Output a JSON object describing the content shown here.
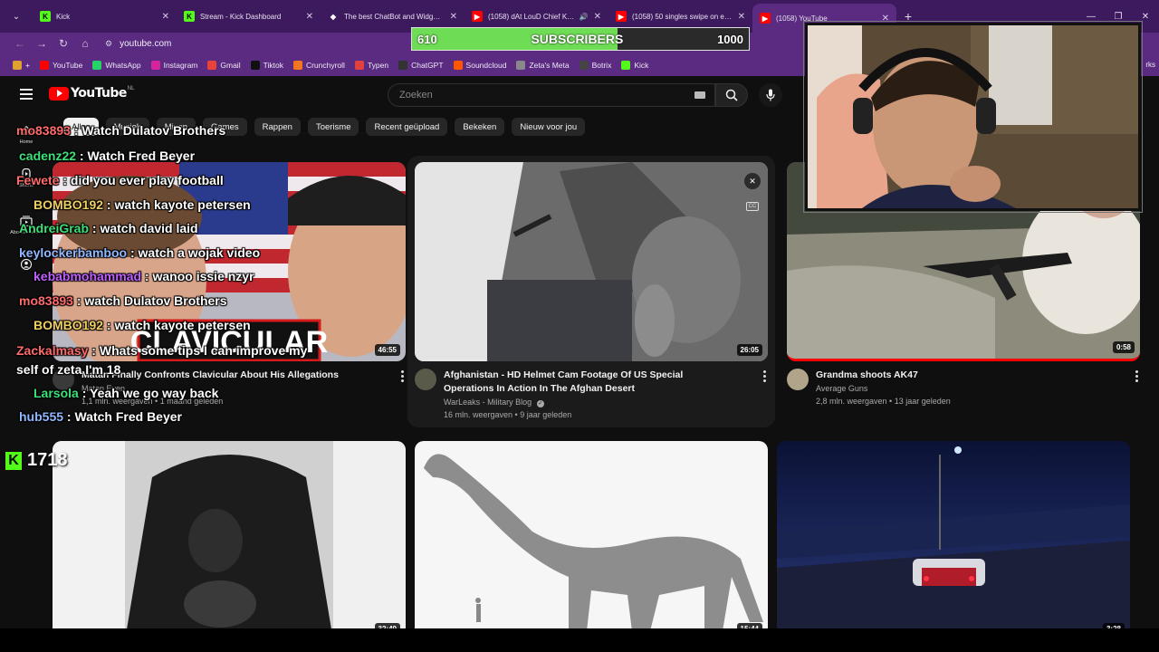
{
  "browser": {
    "tabs": [
      {
        "title": "Kick",
        "favicon": "kick-icon",
        "color": "#53fc18",
        "active": false
      },
      {
        "title": "Stream - Kick Dashboard",
        "favicon": "kick-icon",
        "color": "#53fc18",
        "active": false
      },
      {
        "title": "The best ChatBot and Widgets f...",
        "favicon": "diamond-icon",
        "color": "#ffffff",
        "active": false
      },
      {
        "title": "(1058) dAt LouD Chief Keef",
        "favicon": "youtube-icon",
        "color": "#ff0000",
        "active": false,
        "audio": true
      },
      {
        "title": "(1058) 50 singles swipe on each...",
        "favicon": "youtube-icon",
        "color": "#ff0000",
        "active": false
      },
      {
        "title": "(1058) YouTube",
        "favicon": "youtube-icon",
        "color": "#ff0000",
        "active": true
      }
    ],
    "new_tab": "+",
    "url": "youtube.com",
    "bookmarks": [
      {
        "label": "+",
        "icon": "folder-icon",
        "color": "#e0a030"
      },
      {
        "label": "YouTube",
        "icon": "youtube-icon",
        "color": "#ff0000"
      },
      {
        "label": "WhatsApp",
        "icon": "whatsapp-icon",
        "color": "#25d366"
      },
      {
        "label": "Instagram",
        "icon": "instagram-icon",
        "color": "#d6249f"
      },
      {
        "label": "Gmail",
        "icon": "gmail-icon",
        "color": "#ea4335"
      },
      {
        "label": "Tiktok",
        "icon": "tiktok-icon",
        "color": "#111111"
      },
      {
        "label": "Crunchyroll",
        "icon": "crunchyroll-icon",
        "color": "#f47521"
      },
      {
        "label": "Typen",
        "icon": "typen-icon",
        "color": "#e04040"
      },
      {
        "label": "ChatGPT",
        "icon": "chatgpt-icon",
        "color": "#333333"
      },
      {
        "label": "Soundcloud",
        "icon": "soundcloud-icon",
        "color": "#ff5500"
      },
      {
        "label": "Zeta's Meta",
        "icon": "zeta-icon",
        "color": "#888888"
      },
      {
        "label": "Botrix",
        "icon": "botrix-icon",
        "color": "#444444"
      },
      {
        "label": "Kick",
        "icon": "kick-icon",
        "color": "#53fc18"
      }
    ],
    "bookmarks_more": "rks"
  },
  "overlay": {
    "subscribers": {
      "current": "610",
      "label": "SUBSCRIBERS",
      "goal": "1000",
      "progress": 0.61
    },
    "kick_count": "1718",
    "chat": [
      {
        "user": "mo83893",
        "text": "Watch Dulatov Brothers",
        "color": "#ff6a6a"
      },
      {
        "user": "cadenz22",
        "text": "Watch Fred Beyer",
        "color": "#3ee07a"
      },
      {
        "user": "Fewete",
        "text": "did you ever play football",
        "color": "#ff6a6a"
      },
      {
        "user": "BOMBO192",
        "text": "watch kayote petersen",
        "color": "#f0d060"
      },
      {
        "user": "AndreiGrab",
        "text": "watch david laid",
        "color": "#3ee07a"
      },
      {
        "user": "keylockerbamboo",
        "text": "watch a wojak video",
        "color": "#8fb8ff"
      },
      {
        "user": "kebabmohammad",
        "text": "wanoo issie nzyr",
        "color": "#c060ff"
      },
      {
        "user": "mo83893",
        "text": "watch Dulatov Brothers",
        "color": "#ff6a6a"
      },
      {
        "user": "BOMBO192",
        "text": "watch kayote petersen",
        "color": "#f0d060"
      },
      {
        "user": "Zackalmasy",
        "text": "Whats some tips I can improve my",
        "color": "#ff6a6a"
      },
      {
        "user": "",
        "text": "self of zeta I'm 18",
        "color": "#ffffff"
      },
      {
        "user": "Larsola",
        "text": "Yeah we go way back",
        "color": "#3ee07a"
      },
      {
        "user": "hub555",
        "text": "Watch Fred Beyer",
        "color": "#8fb8ff"
      }
    ]
  },
  "youtube": {
    "logo": "YouTube",
    "country": "NL",
    "search_placeholder": "Zoeken",
    "guide": [
      {
        "label": "Home",
        "icon": "home-icon"
      },
      {
        "label": "Shorts",
        "icon": "shorts-icon"
      },
      {
        "label": "Abonnement...",
        "icon": "subscriptions-icon"
      },
      {
        "label": "",
        "icon": "you-icon"
      }
    ],
    "chips": [
      "Alles",
      "Muziek",
      "Mixen",
      "Games",
      "Rappen",
      "Toerisme",
      "Recent geüpload",
      "Bekeken",
      "Nieuw voor jou"
    ],
    "videos": [
      {
        "title": "Matan Finally Confronts Clavicular About His Allegations",
        "channel": "Matan Even",
        "stats": "1,1 mln. weergaven • 1 maand geleden",
        "duration": "46:55",
        "thumb_text": "CLAVICULAR"
      },
      {
        "title": "Afghanistan - HD Helmet Cam Footage Of US Special Operations In Action In The Afghan Desert",
        "channel": "WarLeaks - Military Blog",
        "stats": "16 mln. weergaven • 9 jaar geleden",
        "duration": "26:05"
      },
      {
        "title": "Grandma shoots AK47",
        "channel": "Average Guns",
        "stats": "2,8 mln. weergaven • 13 jaar geleden",
        "duration": "0:58"
      },
      {
        "title": "",
        "channel": "",
        "stats": "",
        "duration": "32:49"
      },
      {
        "title": "",
        "channel": "",
        "stats": "",
        "duration": "15:44"
      },
      {
        "title": "",
        "channel": "",
        "stats": "",
        "duration": "3:28"
      }
    ]
  }
}
